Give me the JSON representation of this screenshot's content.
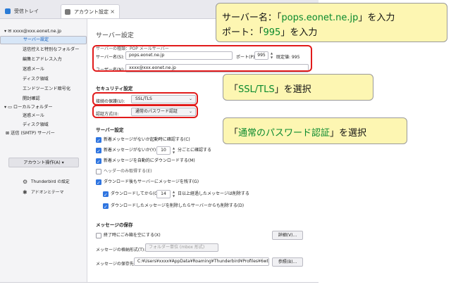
{
  "tabs": [
    {
      "label": "受信トレイ"
    },
    {
      "label": "アカウント設定"
    }
  ],
  "tab_close": "×",
  "sidebar": {
    "account": "xxxx@xxx.eonet.ne.jp",
    "items": [
      {
        "label": "サーバー設定"
      },
      {
        "label": "送信控えと特別なフォルダー"
      },
      {
        "label": "編集とアドレス入力"
      },
      {
        "label": "迷惑メール"
      },
      {
        "label": "ディスク領域"
      },
      {
        "label": "エンドツーエンド暗号化"
      },
      {
        "label": "開封確認"
      }
    ],
    "local_folder": "ローカルフォルダー",
    "local_items": [
      {
        "label": "迷惑メール"
      },
      {
        "label": "ディスク領域"
      }
    ],
    "smtp": "送信 (SMTP) サーバー",
    "account_actions": "アカウント操作(A)",
    "footer": [
      {
        "label": "Thunderbird の設定",
        "icon": "gear-icon"
      },
      {
        "label": "アドオンとテーマ",
        "icon": "puzzle-icon"
      }
    ]
  },
  "main": {
    "title": "サーバー設定",
    "server_type_label": "サーバーの種類：POP メールサーバー",
    "server_name_label": "サーバー名(S):",
    "server_name_value": "pops.eonet.ne.jp",
    "port_label": "ポート(P):",
    "port_value": "995",
    "port_default": "既定値: 995",
    "username_label": "ユーザー名(N):",
    "username_value": "xxxx@xxx.eonet.ne.jp",
    "security_heading": "セキュリティ設定",
    "connection_security_label": "接続の保護(U):",
    "connection_security_value": "SSL/TLS",
    "auth_label": "認証方式(I):",
    "auth_value": "通常のパスワード認証",
    "server_heading": "サーバー設定",
    "options": [
      {
        "label": "新着メッセージがないか起動時に確認する(C)",
        "checked": true
      },
      {
        "label": "新着メッセージがないか(Y)",
        "checked": true,
        "value": "10",
        "suffix": "分ごとに確認する"
      },
      {
        "label": "新着メッセージを自動的にダウンロードする(M)",
        "checked": true
      },
      {
        "label": "ヘッダーのみ取得する(E)",
        "checked": false
      },
      {
        "label": "ダウンロード後もサーバーにメッセージを残す(G)",
        "checked": true
      },
      {
        "label": "ダウンロードしてから(O)",
        "checked": true,
        "value": "14",
        "suffix": "日以上経過したメッセージは削除する"
      },
      {
        "label": "ダウンロードしたメッセージを削除したらサーバーからも削除する(D)",
        "checked": true
      }
    ],
    "storage_heading": "メッセージの保存",
    "empty_trash_label": "終了時にごみ箱を空にする(X)",
    "advanced_button": "詳細(V)...",
    "store_type_label": "メッセージの格納形式(T):",
    "store_type_value": "フォルダー単位 (mbox 形式)",
    "store_path_label": "メッセージの保存先:",
    "store_path_value": "C:¥Users¥xxxx¥AppData¥Roaming¥Thunderbird¥Profiles¥6wtkzt",
    "browse_button": "参照(B)..."
  },
  "callouts": {
    "c1_line1_pre": "サーバー名：「",
    "c1_line1_hl": "pops.eonet.ne.jp",
    "c1_line1_post": "」を入力",
    "c1_line2_pre": "ポート：「",
    "c1_line2_hl": "995",
    "c1_line2_post": "」を入力",
    "c2_pre": "「",
    "c2_hl": "SSL/TLS",
    "c2_post": "」を選択",
    "c3_pre": "「",
    "c3_hl": "通常のパスワード認証",
    "c3_post": "」を選択"
  },
  "colors": {
    "highlight_red": "#e11b1b",
    "callout_bg": "#fdf6b2",
    "callout_text_green": "#0a8a2e",
    "checkbox_blue": "#2f75e0"
  }
}
